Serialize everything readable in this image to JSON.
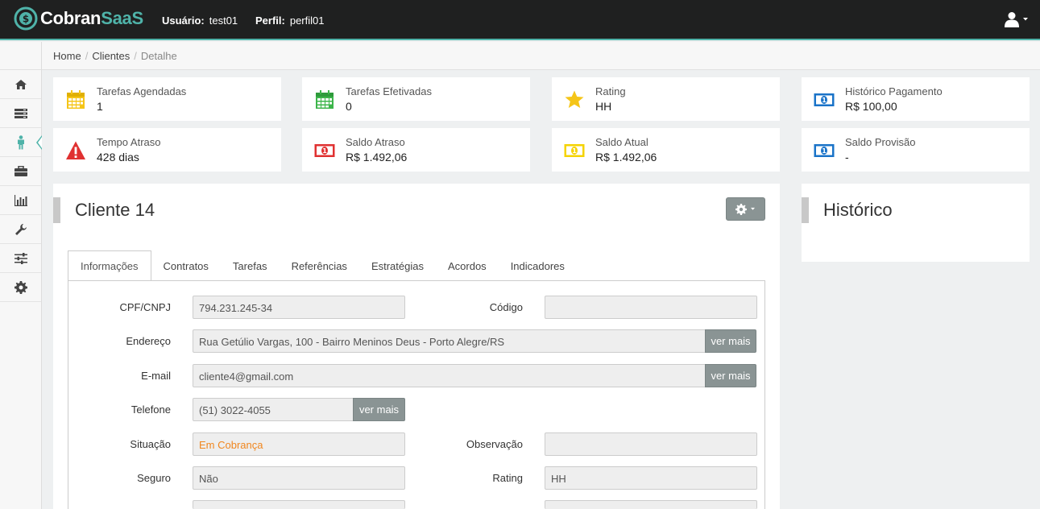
{
  "brand": {
    "name_part1": "Cobran",
    "name_part2": "SaaS",
    "accent": "#4fb3a9"
  },
  "header": {
    "user_label": "Usuário:",
    "user_value": "test01",
    "profile_label": "Perfil:",
    "profile_value": "perfil01",
    "user_icon": "user-icon"
  },
  "breadcrumb": {
    "home": "Home",
    "clientes": "Clientes",
    "current": "Detalhe",
    "separator": "/"
  },
  "sidebar": {
    "items": [
      {
        "icon": "home-icon"
      },
      {
        "icon": "list-icon"
      },
      {
        "icon": "person-icon",
        "active": true
      },
      {
        "icon": "briefcase-icon"
      },
      {
        "icon": "bar-chart-icon"
      },
      {
        "icon": "wrench-icon"
      },
      {
        "icon": "sliders-icon"
      },
      {
        "icon": "gear-icon"
      }
    ]
  },
  "stats": [
    {
      "label": "Tarefas Agendadas",
      "value": "1",
      "icon": "calendar-icon",
      "color": "#f5c518"
    },
    {
      "label": "Tarefas Efetivadas",
      "value": "0",
      "icon": "calendar-icon",
      "color": "#3cb54a"
    },
    {
      "label": "Rating",
      "value": "HH",
      "icon": "star-icon",
      "color": "#f5c518"
    },
    {
      "label": "Histórico Pagamento",
      "value": "R$ 100,00",
      "icon": "money-icon",
      "color": "#1a73c8"
    },
    {
      "label": "Tempo Atraso",
      "value": "428 dias",
      "icon": "warning-icon",
      "color": "#e03131"
    },
    {
      "label": "Saldo Atraso",
      "value": "R$ 1.492,06",
      "icon": "money-icon",
      "color": "#e03131"
    },
    {
      "label": "Saldo Atual",
      "value": "R$ 1.492,06",
      "icon": "money-icon",
      "color": "#f5d300"
    },
    {
      "label": "Saldo Provisão",
      "value": "-",
      "icon": "money-icon",
      "color": "#1a73c8"
    }
  ],
  "client_panel": {
    "title": "Cliente 14",
    "tabs": [
      "Informações",
      "Contratos",
      "Tarefas",
      "Referências",
      "Estratégias",
      "Acordos",
      "Indicadores"
    ],
    "active_tab": 0,
    "fields": {
      "cpf_label": "CPF/CNPJ",
      "cpf_value": "794.231.245-34",
      "codigo_label": "Código",
      "codigo_value": "",
      "endereco_label": "Endereço",
      "endereco_value": "Rua Getúlio Vargas, 100  - Bairro Meninos Deus - Porto Alegre/RS",
      "email_label": "E-mail",
      "email_value": "cliente4@gmail.com",
      "telefone_label": "Telefone",
      "telefone_value": "(51) 3022-4055",
      "situacao_label": "Situação",
      "situacao_value": "Em Cobrança",
      "observacao_label": "Observação",
      "observacao_value": "",
      "seguro_label": "Seguro",
      "seguro_value": "Não",
      "rating_label": "Rating",
      "rating_value": "HH"
    },
    "more_button": "ver mais"
  },
  "history_panel": {
    "title": "Histórico"
  }
}
